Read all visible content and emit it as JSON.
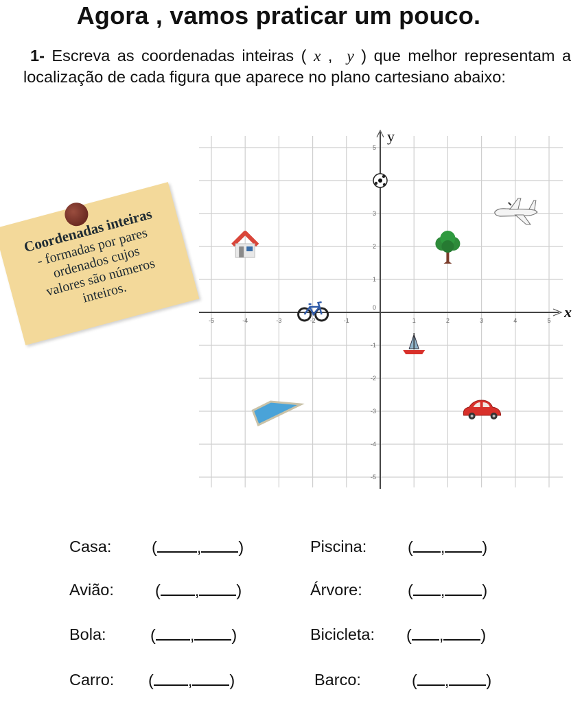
{
  "title": "Agora , vamos praticar um pouco.",
  "question": {
    "number": "1-",
    "text_before": "Escreva as coordenadas inteiras (",
    "var_x": "x",
    "comma": ",",
    "var_y": "y",
    "text_after": ") que melhor representam a localização de cada figura que aparece no plano cartesiano abaixo:"
  },
  "note": {
    "heading": "Coordenadas inteiras",
    "lines": [
      "- formadas por pares",
      "ordenados cujos",
      "valores são números",
      "inteiros."
    ],
    "color": "#f3d99a",
    "pin_color": "#7a3328"
  },
  "chart_data": {
    "type": "scatter",
    "title": "",
    "xlabel": "x",
    "ylabel": "y",
    "xlim": [
      -5,
      5
    ],
    "ylim": [
      -5,
      5
    ],
    "grid": true,
    "x_ticks": [
      "-5",
      "-4",
      "-3",
      "-2",
      "-1",
      "1",
      "2",
      "3",
      "4",
      "5"
    ],
    "y_ticks": [
      "5",
      "4",
      "3",
      "2",
      "1",
      "0",
      "-1",
      "-2",
      "-3",
      "-4",
      "-5"
    ],
    "points": [
      {
        "name": "Casa",
        "icon": "house-icon",
        "x": -4,
        "y": 2
      },
      {
        "name": "Avião",
        "icon": "airplane-icon",
        "x": 4,
        "y": 3
      },
      {
        "name": "Bola",
        "icon": "soccer-ball-icon",
        "x": 0,
        "y": 4
      },
      {
        "name": "Carro",
        "icon": "car-icon",
        "x": 3,
        "y": -3
      },
      {
        "name": "Piscina",
        "icon": "pool-icon",
        "x": -3,
        "y": -3
      },
      {
        "name": "Árvore",
        "icon": "tree-icon",
        "x": 2,
        "y": 2
      },
      {
        "name": "Bicicleta",
        "icon": "bicycle-icon",
        "x": -2,
        "y": 0
      },
      {
        "name": "Barco",
        "icon": "sailboat-icon",
        "x": 1,
        "y": -1
      }
    ]
  },
  "answers": [
    {
      "label": "Casa:",
      "blank": "(",
      "sep": ",",
      "close": ")"
    },
    {
      "label": "Avião:",
      "blank": "(",
      "sep": ",",
      "close": ")"
    },
    {
      "label": "Bola:",
      "blank": "(",
      "sep": ",",
      "close": ")"
    },
    {
      "label": "Carro:",
      "blank": "(",
      "sep": ",",
      "close": ")"
    },
    {
      "label": "Piscina:",
      "blank": "(",
      "sep": ",",
      "close": ")"
    },
    {
      "label": "Árvore:",
      "blank": "(",
      "sep": ",",
      "close": ")"
    },
    {
      "label": "Bicicleta:",
      "blank": "(",
      "sep": ",",
      "close": ")"
    },
    {
      "label": "Barco:",
      "blank": "(",
      "sep": ",",
      "close": ")"
    }
  ]
}
